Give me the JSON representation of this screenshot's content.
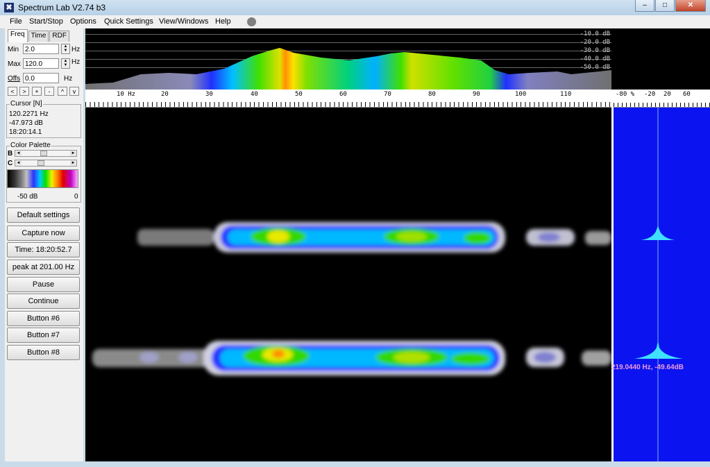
{
  "window": {
    "title": "Spectrum Lab V2.74 b3",
    "min_icon": "minimize-icon",
    "max_icon": "maximize-icon",
    "close_icon": "close-icon"
  },
  "menu": [
    "File",
    "Start/Stop",
    "Options",
    "Quick Settings",
    "View/Windows",
    "Help"
  ],
  "tabs": [
    "Freq",
    "Time",
    "RDF"
  ],
  "freq_panel": {
    "min_label": "Min",
    "min_value": "2.0",
    "min_unit": "Hz",
    "max_label": "Max",
    "max_value": "120.0",
    "max_unit": "Hz",
    "offs_label": "Offs",
    "offs_value": "0.0",
    "offs_unit": "Hz",
    "nav_buttons": [
      "<",
      ">",
      "+",
      "-",
      "^",
      "v"
    ]
  },
  "cursor": {
    "title": "Cursor [N]",
    "freq": "120.2271 Hz",
    "level": "-47.973 dB",
    "time": "18:20:14.1"
  },
  "palette": {
    "title": "Color Palette",
    "b_label": "B",
    "c_label": "C",
    "b_pos": 0.45,
    "c_pos": 0.38,
    "min_label": "-50 dB",
    "max_label": "0"
  },
  "buttons": [
    "Default settings",
    "Capture now",
    "Time:  18:20:52.7",
    "peak at 201.00 Hz",
    "Pause",
    "Continue",
    "Button #6",
    "Button #7",
    "Button #8"
  ],
  "spectrum": {
    "db_labels": [
      "-10.0 dB",
      "-20.0 dB",
      "-30.0 dB",
      "-40.0 dB",
      "-50.0 dB"
    ]
  },
  "freq_axis": {
    "unit_label": "10 Hz",
    "ticks": [
      "20",
      "30",
      "40",
      "50",
      "60",
      "70",
      "80",
      "90",
      "100",
      "110"
    ]
  },
  "amp_axis": {
    "ticks": [
      "-80 %",
      "-20",
      "20",
      "60"
    ]
  },
  "marker": {
    "text": "219.0440 Hz, -49.64dB"
  },
  "colors": {
    "spectrum_bg": "#000000",
    "side_plot_bg": "#0b14f0",
    "marker_text": "#f09ae0",
    "trace": "#40e0ff"
  }
}
